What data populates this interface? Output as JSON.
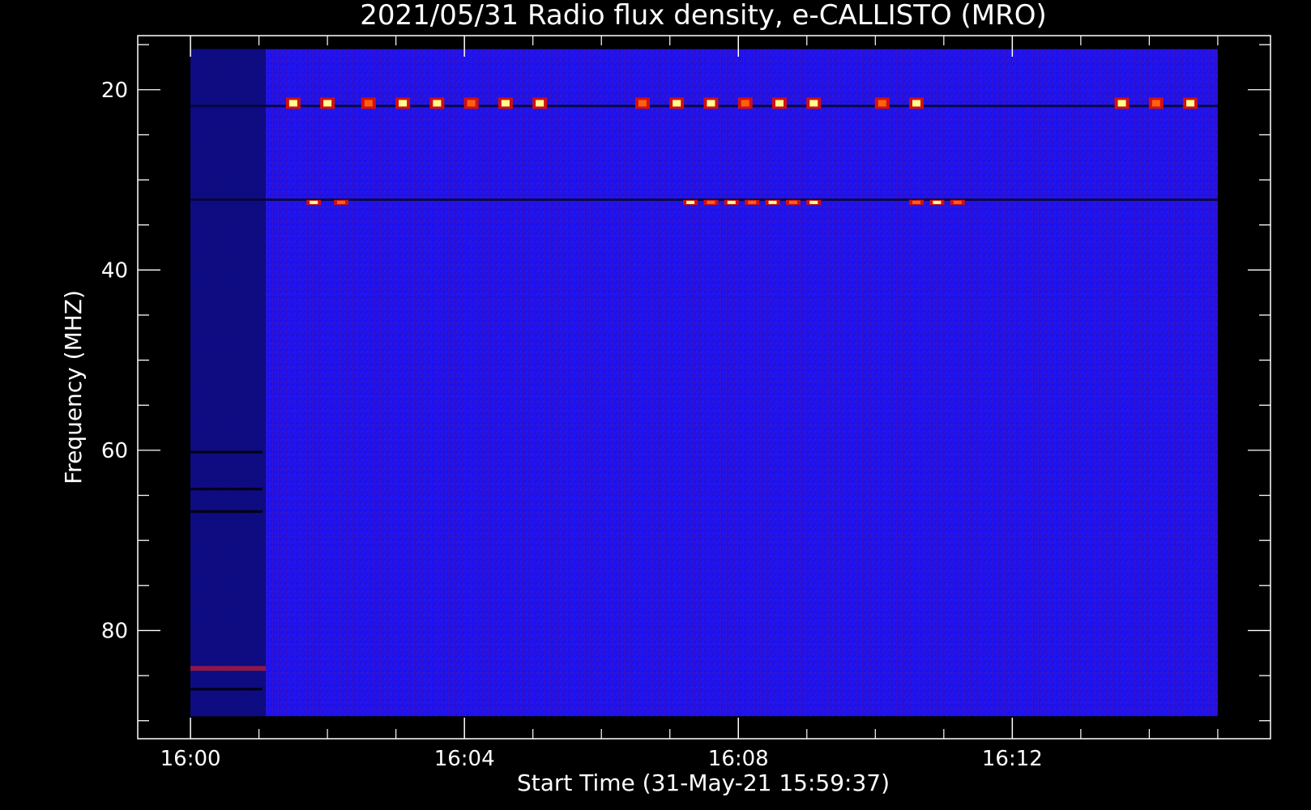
{
  "chart_data": {
    "type": "heatmap",
    "title": "2021/05/31  Radio flux density, e-CALLISTO (MRO)",
    "xlabel": "Start Time (31-May-21 15:59:37)",
    "ylabel": "Frequency (MHZ)",
    "x_ticks": [
      {
        "label": "16:00",
        "minute": 0
      },
      {
        "label": "16:04",
        "minute": 4
      },
      {
        "label": "16:08",
        "minute": 8
      },
      {
        "label": "16:12",
        "minute": 12
      }
    ],
    "xlim_minutes": [
      -0.77,
      15.77
    ],
    "y_ticks": [
      20,
      40,
      60,
      80
    ],
    "ylim": [
      14,
      92
    ],
    "y_inverted": true,
    "colormap": [
      "#000000",
      "#0000ff",
      "#8b0000",
      "#ff4000",
      "#ffff80",
      "#ffffff"
    ],
    "bursts": [
      {
        "freq_mhz": 21.5,
        "minutes": [
          1.5,
          2.0,
          2.6,
          3.1,
          3.6,
          4.1,
          4.6,
          5.1,
          6.6,
          7.1,
          7.6,
          8.1,
          8.6,
          9.1,
          10.1,
          10.6,
          13.6,
          14.1,
          14.6
        ]
      },
      {
        "freq_mhz": 32.5,
        "minutes": [
          1.8,
          2.2,
          7.3,
          7.6,
          7.9,
          8.2,
          8.5,
          8.8,
          9.1,
          10.6,
          10.9,
          11.2
        ]
      }
    ],
    "colors": {
      "background": "#000000",
      "axes": "#ffffff",
      "field": "#1a10f0"
    }
  }
}
